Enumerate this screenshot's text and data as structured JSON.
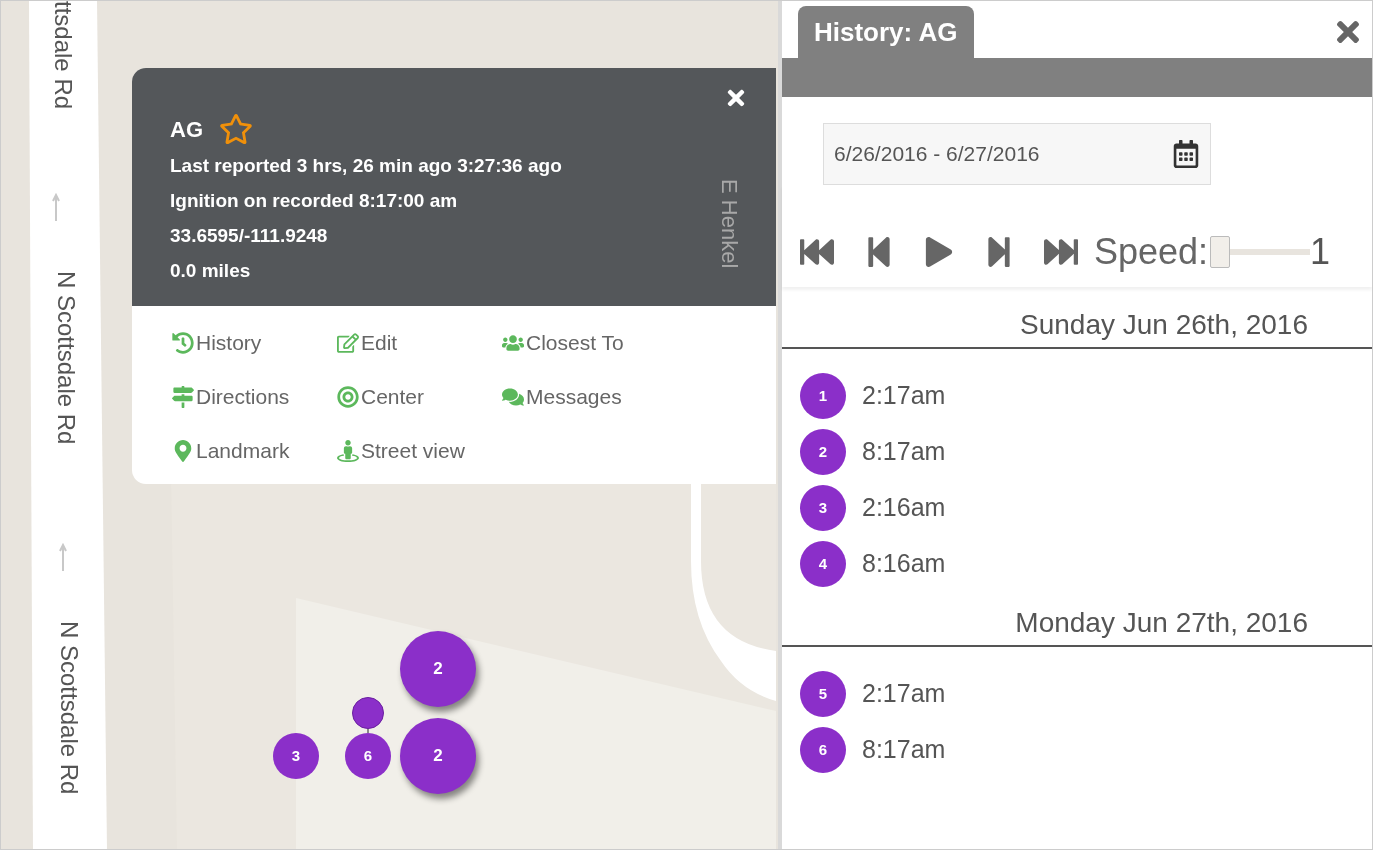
{
  "map": {
    "street_labels": [
      {
        "text": "ttsdale Rd",
        "kind": "main"
      },
      {
        "text": "N Scottsdale Rd",
        "kind": "main"
      },
      {
        "text": "N Scottsdale Rd",
        "kind": "main"
      },
      {
        "text": "E Henkel",
        "kind": "side"
      }
    ],
    "markers": [
      {
        "label": "2",
        "kind": "cluster"
      },
      {
        "kind": "pin"
      },
      {
        "label": "3",
        "kind": "point"
      },
      {
        "label": "6",
        "kind": "point"
      },
      {
        "label": "2",
        "kind": "cluster"
      }
    ]
  },
  "popup": {
    "title": "AG",
    "favorite": false,
    "lines": [
      "Last reported 3 hrs, 26 min ago 3:27:36 ago",
      "Ignition on recorded 8:17:00 am",
      "33.6595/-111.9248",
      "0.0 miles"
    ],
    "actions": [
      {
        "label": "History",
        "kind": "history"
      },
      {
        "label": "Edit",
        "kind": "edit"
      },
      {
        "label": "Closest To",
        "kind": "group"
      },
      {
        "label": "Directions",
        "kind": "signpost"
      },
      {
        "label": "Center",
        "kind": "center"
      },
      {
        "label": "Messages",
        "kind": "messages"
      },
      {
        "label": "Landmark",
        "kind": "landmark"
      },
      {
        "label": "Street view",
        "kind": "streetview"
      }
    ]
  },
  "history_panel": {
    "tab": {
      "label": "History: AG",
      "selected": true
    },
    "date_range": "6/26/2016 - 6/27/2016",
    "playback": [
      {
        "kind": "first"
      },
      {
        "kind": "prev"
      },
      {
        "kind": "play"
      },
      {
        "kind": "next"
      },
      {
        "kind": "last"
      }
    ],
    "speed": {
      "label": "Speed:",
      "level": 0,
      "reading": "1"
    },
    "days": [
      {
        "heading": "Sunday Jun 26th, 2016",
        "entries": [
          {
            "number": "1",
            "time": "2:17am"
          },
          {
            "number": "2",
            "time": "8:17am"
          },
          {
            "number": "3",
            "time": "2:16am"
          },
          {
            "number": "4",
            "time": "8:16am"
          }
        ]
      },
      {
        "heading": "Monday Jun 27th, 2016",
        "entries": [
          {
            "number": "5",
            "time": "2:17am"
          },
          {
            "number": "6",
            "time": "8:17am"
          }
        ]
      }
    ]
  }
}
